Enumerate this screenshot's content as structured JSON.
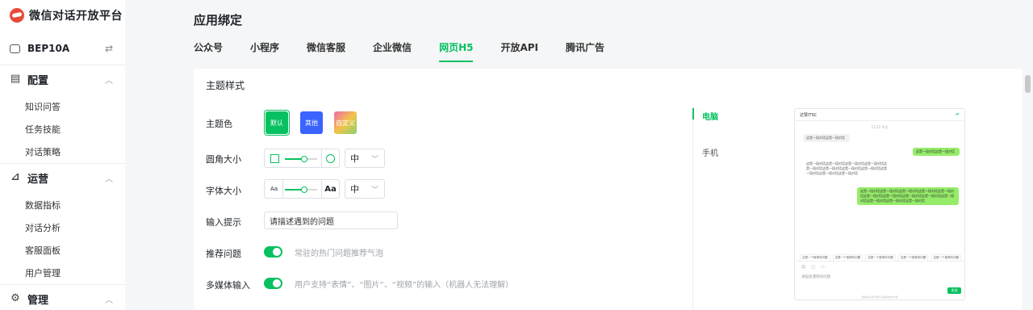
{
  "brand": {
    "title": "微信对话开放平台"
  },
  "bot": {
    "name": "BEP10A",
    "switch": "⇄"
  },
  "sidebar": {
    "groups": [
      {
        "label": "配置",
        "items": [
          "知识问答",
          "任务技能",
          "对话策略"
        ]
      },
      {
        "label": "运营",
        "items": [
          "数据指标",
          "对话分析",
          "客服面板",
          "用户管理"
        ]
      },
      {
        "label": "管理"
      }
    ]
  },
  "page": {
    "title": "应用绑定"
  },
  "tabs": [
    "公众号",
    "小程序",
    "微信客服",
    "企业微信",
    "网页H5",
    "开放API",
    "腾讯广告"
  ],
  "active_tab": "网页H5",
  "theme": {
    "section_title": "主题样式",
    "color_label": "主题色",
    "swatches": [
      {
        "label": "默认",
        "color": "#07c160"
      },
      {
        "label": "其他",
        "color": "#3a63ff"
      },
      {
        "label": "自定义",
        "color": "#f0a850"
      }
    ],
    "radius_label": "圆角大小",
    "radius_value": "中",
    "radius_level": 0.6,
    "font_label": "字体大小",
    "font_small": "Aa",
    "font_large": "Aa",
    "font_value": "中",
    "font_level": 0.6,
    "input_label": "输入提示",
    "input_value": "请描述遇到的问题",
    "recommend_label": "推荐问题",
    "recommend_on": true,
    "recommend_hint": "常驻的热门问题推荐气泡",
    "media_label": "多媒体输入",
    "media_on": true,
    "media_hint": "用户支持“表情”、“图片”、“视频”的输入（机器人无法理解）"
  },
  "preview": {
    "tabs": [
      "电脑",
      "手机"
    ],
    "active": "电脑",
    "header_title": "达赞iTSC",
    "time": "17:22 今天",
    "bubble_1": "这是一段对话这是一段对话",
    "bubble_2": "这是一段对话这是一段对话",
    "bubble_3": "这是一段对话这是一段对话这是一段对话这是一段对话这是一段对话这是一段对话这是一段对话这是一段对话这是一段对话这是一段对话这是一段对话",
    "bubble_4": "这是一段对话这是一段对话这是一段对话这是一段对话这是一段对话这是一段对话这是一段对话这是一段对话这是一段对话这是一段对话这是一段对话这是一段对话这是一段对话",
    "chips": [
      "这是一个推荐的问题",
      "这是一个推荐的问题",
      "这是一个推荐的问题",
      "这是一个推荐的问题",
      "这是一个推荐的问题"
    ],
    "input_placeholder": "请描述遇到的问题",
    "send": "发送",
    "footer": "服务由对话开放平台提供技术支持"
  },
  "colors": {
    "accent": "#07c160"
  }
}
